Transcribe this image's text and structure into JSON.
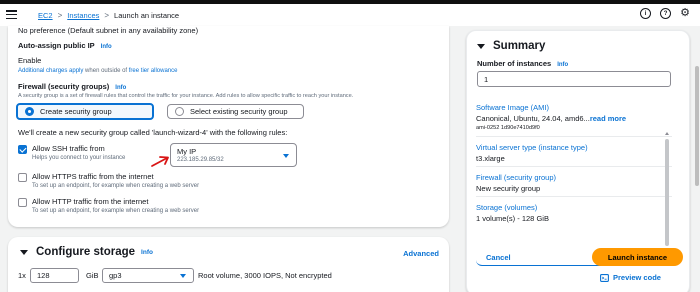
{
  "breadcrumb": {
    "ec2": "EC2",
    "instances": "Instances",
    "current": "Launch an instance",
    "separator": ">"
  },
  "header_icons": {
    "info": "i",
    "help": "?",
    "settings": "⚙"
  },
  "network": {
    "subnet_value": "No preference (Default subnet in any availability zone)",
    "auto_assign_label": "Auto-assign public IP",
    "auto_assign_info": "Info",
    "auto_assign_value": "Enable",
    "charges_text_1": "Additional charges apply",
    "charges_text_2": " when outside of ",
    "charges_text_3": "free tier allowance",
    "firewall_label": "Firewall (security groups)",
    "firewall_info": "Info",
    "firewall_desc": "A security group is a set of firewall rules that control the traffic for your instance. Add rules to allow specific traffic to reach your instance.",
    "radio_create": "Create security group",
    "radio_existing": "Select existing security group",
    "sg_sentence": "We'll create a new security group called 'launch-wizard-4' with the following rules:",
    "rules": [
      {
        "label": "Allow SSH traffic from",
        "desc": "Helps you connect to your instance",
        "checked": true
      },
      {
        "label": "Allow HTTPS traffic from the internet",
        "desc": "To set up an endpoint, for example when creating a web server",
        "checked": false
      },
      {
        "label": "Allow HTTP traffic from the internet",
        "desc": "To set up an endpoint, for example when creating a web server",
        "checked": false
      }
    ],
    "ssh_source": {
      "value": "My IP",
      "sub": "223.185.29.85/32"
    }
  },
  "storage": {
    "title": "Configure storage",
    "info": "Info",
    "advanced": "Advanced",
    "multiplier": "1x",
    "size": "128",
    "unit": "GiB",
    "type": "gp3",
    "desc": "Root volume,  3000 IOPS,  Not encrypted"
  },
  "summary": {
    "title": "Summary",
    "instances_label": "Number of instances",
    "instances_info": "Info",
    "instances_value": "1",
    "items": [
      {
        "key": "Software Image (AMI)",
        "value": "Canonical, Ubuntu, 24.04, amd6...",
        "more": "read more",
        "sub": "ami-0252 1d90e7410d9f0"
      },
      {
        "key": "Virtual server type (instance type)",
        "value": "t3.xlarge"
      },
      {
        "key": "Firewall (security group)",
        "value": "New security group"
      },
      {
        "key": "Storage (volumes)",
        "value": "1 volume(s) - 128 GiB"
      }
    ],
    "cancel": "Cancel",
    "launch": "Launch instance",
    "preview": "Preview code"
  },
  "colors": {
    "accent": "#0972d3",
    "launch": "#ff9900",
    "annotation_arrow": "#d91515"
  }
}
